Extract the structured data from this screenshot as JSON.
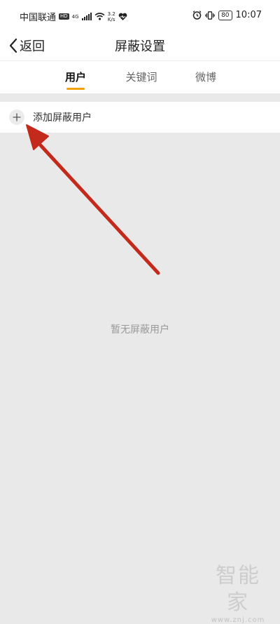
{
  "status_bar": {
    "carrier": "中国联通",
    "hd_badge": "HD",
    "network_type": "4G",
    "net_speed_value": "3.2",
    "net_speed_unit": "K/s",
    "battery_level": "80",
    "time": "10:07"
  },
  "nav": {
    "back_label": "返回",
    "title": "屏蔽设置"
  },
  "tabs": [
    {
      "label": "用户",
      "active": true
    },
    {
      "label": "关键词",
      "active": false
    },
    {
      "label": "微博",
      "active": false
    }
  ],
  "add_row": {
    "label": "添加屏蔽用户"
  },
  "empty_state": {
    "text": "暂无屏蔽用户"
  },
  "watermark": {
    "logo": "智能家",
    "url": "www.znj.com"
  },
  "colors": {
    "accent": "#f3a10b",
    "annotation_arrow": "#c42a1c",
    "background": "#e9e9e9"
  }
}
